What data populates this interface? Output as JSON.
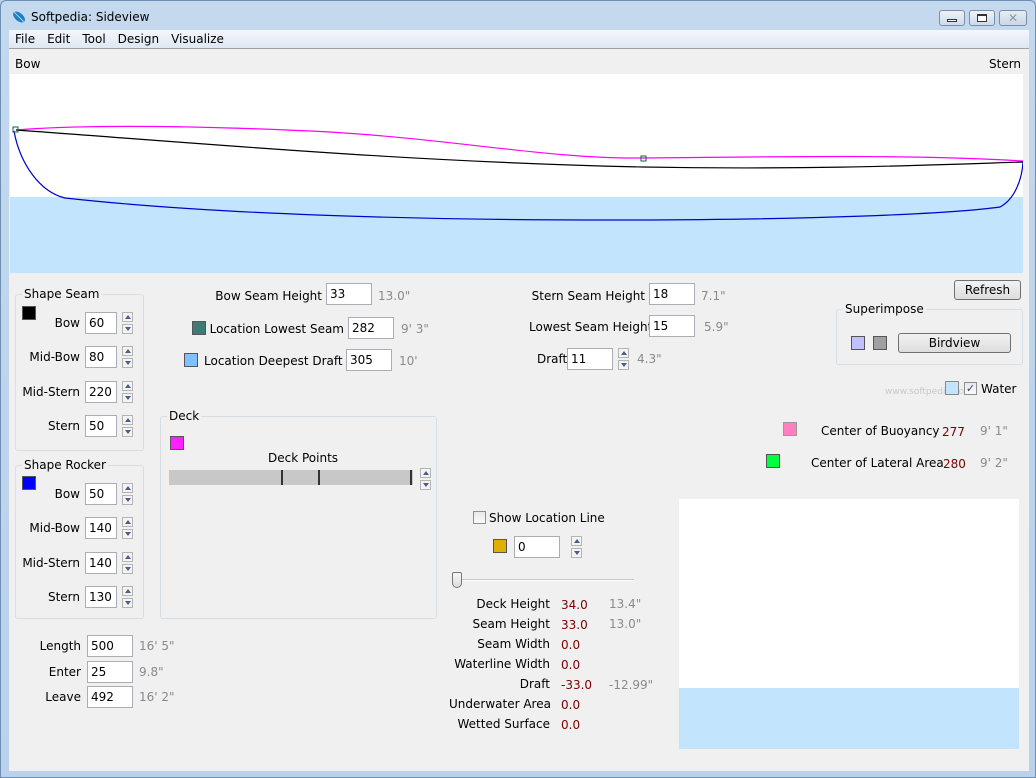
{
  "window": {
    "title": "Softpedia: Sideview",
    "controls": [
      "minimize",
      "maximize",
      "close"
    ]
  },
  "menu": [
    "File",
    "Edit",
    "Tool",
    "Design",
    "Visualize"
  ],
  "sideview": {
    "bow_label": "Bow",
    "stern_label": "Stern",
    "colors": {
      "water": "#c2e4fc",
      "deck": "#ff00ff",
      "seam": "#000000",
      "rocker": "#0000ff"
    }
  },
  "shape_seam": {
    "title": "Shape Seam",
    "color": "#000000",
    "fields": [
      {
        "label": "Bow",
        "value": "60"
      },
      {
        "label": "Mid-Bow",
        "value": "80"
      },
      {
        "label": "Mid-Stern",
        "value": "220"
      },
      {
        "label": "Stern",
        "value": "50"
      }
    ]
  },
  "shape_rocker": {
    "title": "Shape Rocker",
    "color": "#0000ff",
    "fields": [
      {
        "label": "Bow",
        "value": "50"
      },
      {
        "label": "Mid-Bow",
        "value": "140"
      },
      {
        "label": "Mid-Stern",
        "value": "140"
      },
      {
        "label": "Stern",
        "value": "130"
      }
    ]
  },
  "dimensions": {
    "length": {
      "label": "Length",
      "value": "500",
      "imperial": "16' 5\""
    },
    "enter": {
      "label": "Enter",
      "value": "25",
      "imperial": "9.8\""
    },
    "leave": {
      "label": "Leave",
      "value": "492",
      "imperial": "16' 2\""
    }
  },
  "seam_params": {
    "bow_seam_height": {
      "label": "Bow Seam Height",
      "value": "33",
      "imperial": "13.0\""
    },
    "location_lowest_seam": {
      "label": "Location Lowest Seam",
      "value": "282",
      "imperial": "9' 3\"",
      "color": "#3e7a78"
    },
    "location_deepest_draft": {
      "label": "Location Deepest Draft",
      "value": "305",
      "imperial": "10'",
      "color": "#80c0ff"
    },
    "stern_seam_height": {
      "label": "Stern Seam Height",
      "value": "18",
      "imperial": "7.1\""
    },
    "lowest_seam_height": {
      "label": "Lowest Seam Height",
      "value": "15",
      "imperial": "5.9\""
    },
    "draft": {
      "label": "Draft",
      "value": "11",
      "imperial": "4.3\""
    }
  },
  "deck": {
    "title": "Deck",
    "color": "#ff20ff",
    "points_label": "Deck Points"
  },
  "refresh_label": "Refresh",
  "superimpose": {
    "title": "Superimpose",
    "color1": "#c0c0ff",
    "color2": "#a0a0a0",
    "birdview_label": "Birdview",
    "watermark": "www.softpedia.com"
  },
  "water": {
    "label": "Water",
    "checked": true,
    "color": "#c2e4fc"
  },
  "centers": {
    "buoyancy": {
      "label": "Center of Buoyancy",
      "value": "277",
      "imperial": "9' 1\"",
      "color": "#ff80c0"
    },
    "lateral": {
      "label": "Center of Lateral Area",
      "value": "280",
      "imperial": "9' 2\"",
      "color": "#00ff40"
    }
  },
  "location_line": {
    "label": "Show Location Line",
    "checked": false,
    "color": "#e0b000",
    "value": "0",
    "slider_fraction": 0.0
  },
  "stats": [
    {
      "label": "Deck Height",
      "value": "34.0",
      "imperial": "13.4\""
    },
    {
      "label": "Seam Height",
      "value": "33.0",
      "imperial": "13.0\""
    },
    {
      "label": "Seam Width",
      "value": "0.0",
      "imperial": ""
    },
    {
      "label": "Waterline Width",
      "value": "0.0",
      "imperial": ""
    },
    {
      "label": "Draft",
      "value": "-33.0",
      "imperial": "-12.99\""
    },
    {
      "label": "Underwater Area",
      "value": "0.0",
      "imperial": ""
    },
    {
      "label": "Wetted Surface",
      "value": "0.0",
      "imperial": ""
    }
  ]
}
